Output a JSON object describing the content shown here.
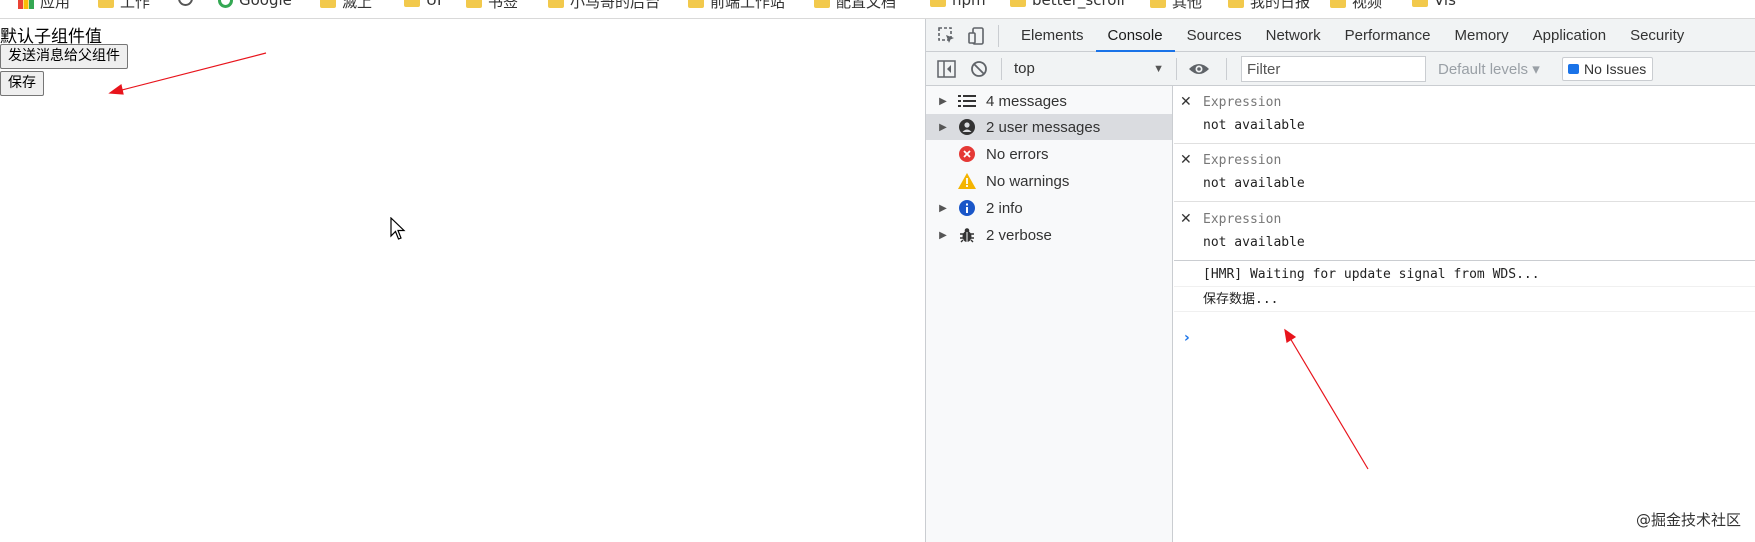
{
  "bookmarks": {
    "items": [
      {
        "label": "应用",
        "icon": "apps-icon"
      },
      {
        "label": "工作",
        "icon": "folder-icon"
      },
      {
        "label": "",
        "icon": "history-icon"
      },
      {
        "label": "Google",
        "icon": "google-icon"
      },
      {
        "label": "滅上",
        "icon": "folder-icon"
      },
      {
        "label": "UI",
        "icon": "folder-icon"
      },
      {
        "label": "书签",
        "icon": "folder-icon"
      },
      {
        "label": "小马哥的后台",
        "icon": "folder-icon"
      },
      {
        "label": "前端工作站",
        "icon": "folder-icon"
      },
      {
        "label": "配置文档",
        "icon": "folder-icon"
      },
      {
        "label": "npm",
        "icon": "folder-icon"
      },
      {
        "label": "better_scroll",
        "icon": "folder-icon"
      },
      {
        "label": "其他",
        "icon": "folder-icon"
      },
      {
        "label": "我的日报",
        "icon": "folder-icon"
      },
      {
        "label": "视频",
        "icon": "folder-icon"
      },
      {
        "label": "Vis",
        "icon": "folder-icon"
      }
    ]
  },
  "page": {
    "title": "默认子组件值",
    "send_button": "发送消息给父组件",
    "save_button": "保存"
  },
  "devtools": {
    "tabs": [
      "Elements",
      "Console",
      "Sources",
      "Network",
      "Performance",
      "Memory",
      "Application",
      "Security"
    ],
    "active_tab": "Console",
    "toolbar": {
      "context": "top",
      "filter_placeholder": "Filter",
      "levels": "Default levels ▾",
      "issues": "No Issues"
    },
    "sidebar": [
      {
        "label": "4 messages",
        "icon": "list-icon",
        "expandable": true
      },
      {
        "label": "2 user messages",
        "icon": "user-icon",
        "expandable": true,
        "selected": true
      },
      {
        "label": "No errors",
        "icon": "error-icon",
        "expandable": false
      },
      {
        "label": "No warnings",
        "icon": "warning-icon",
        "expandable": false
      },
      {
        "label": "2 info",
        "icon": "info-icon",
        "expandable": true
      },
      {
        "label": "2 verbose",
        "icon": "bug-icon",
        "expandable": true
      }
    ],
    "expressions": [
      {
        "label": "Expression",
        "value": "not available"
      },
      {
        "label": "Expression",
        "value": "not available"
      },
      {
        "label": "Expression",
        "value": "not available"
      }
    ],
    "logs": [
      "[HMR] Waiting for update signal from WDS...",
      "保存数据..."
    ],
    "prompt": "›"
  },
  "watermark": "@掘金技术社区",
  "colors": {
    "accent": "#1a73e8",
    "annotation_arrow": "#e8141c"
  }
}
